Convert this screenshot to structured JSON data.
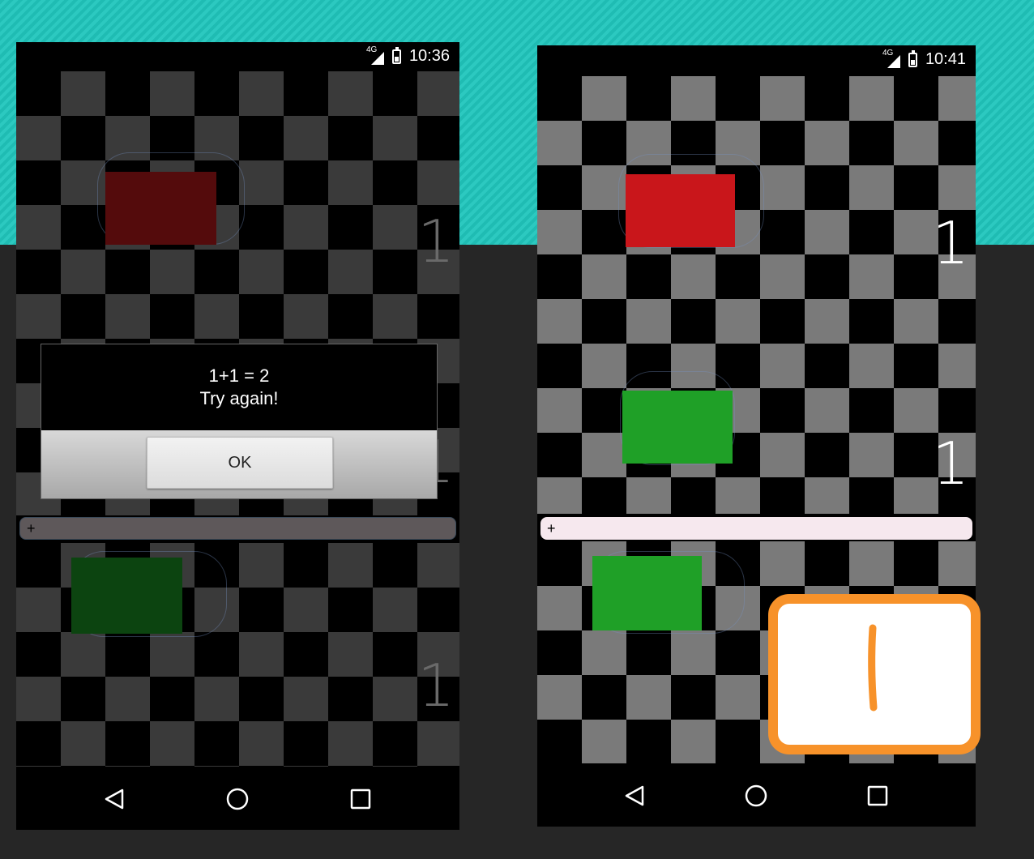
{
  "left_screen": {
    "status": {
      "network": "4G",
      "time": "10:36"
    },
    "board_digits": [
      "1",
      "1",
      "1"
    ],
    "input_plus": "+",
    "dialog": {
      "line1": "1+1 = 2",
      "line2": "Try again!",
      "ok_label": "OK"
    },
    "colors": {
      "top_rect": "#540b0c",
      "bottom_rect": "#0c4410"
    }
  },
  "right_screen": {
    "status": {
      "network": "4G",
      "time": "10:41"
    },
    "board_digits": [
      "1",
      "1"
    ],
    "input_plus": "+",
    "colors": {
      "top_rect": "#c9161b",
      "middle_rect": "#1fa027",
      "bottom_rect": "#1fa027"
    }
  },
  "nav_icons": [
    "back-icon",
    "home-icon",
    "recents-icon"
  ],
  "highlight": {
    "border_color": "#f7922a",
    "handwritten_digit": "1"
  }
}
